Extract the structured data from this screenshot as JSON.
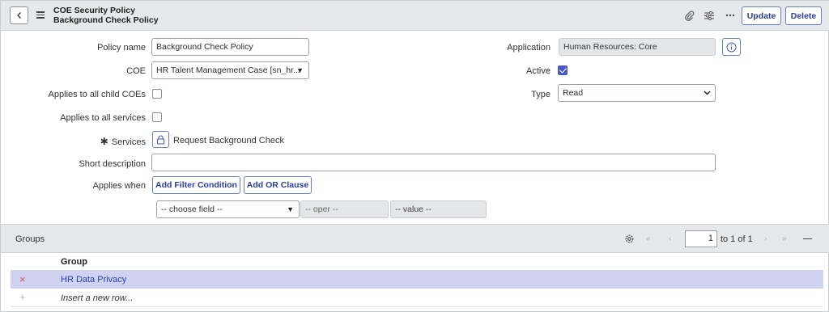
{
  "header": {
    "title_line1": "COE Security Policy",
    "title_line2": "Background Check Policy",
    "update_label": "Update",
    "delete_label": "Delete"
  },
  "form": {
    "policy_name_label": "Policy name",
    "policy_name_value": "Background Check Policy",
    "coe_label": "COE",
    "coe_value": "HR Talent Management Case [sn_hr...",
    "applies_child_label": "Applies to all child COEs",
    "applies_services_label": "Applies to all services",
    "services_required_mark": "✱",
    "services_label": "Services",
    "services_value": "Request Background Check",
    "short_desc_label": "Short description",
    "short_desc_value": "",
    "applies_when_label": "Applies when",
    "add_filter_label": "Add Filter Condition",
    "add_or_label": "Add OR Clause",
    "choose_field": "-- choose field --",
    "oper": "-- oper --",
    "value": "-- value --",
    "application_label": "Application",
    "application_value": "Human Resources: Core",
    "active_label": "Active",
    "active_checked": true,
    "type_label": "Type",
    "type_value": "Read"
  },
  "groups": {
    "title": "Groups",
    "page_value": "1",
    "page_of": "to 1 of 1",
    "column_header": "Group",
    "rows": [
      {
        "name": "HR Data Privacy",
        "action": "×"
      }
    ],
    "insert_row": "Insert a new row...",
    "insert_action": "+"
  },
  "colors": {
    "accent": "#4a58c9",
    "link": "#2b3ea0",
    "selected_row": "#cfd3f1",
    "delete_x": "#d9534f"
  }
}
